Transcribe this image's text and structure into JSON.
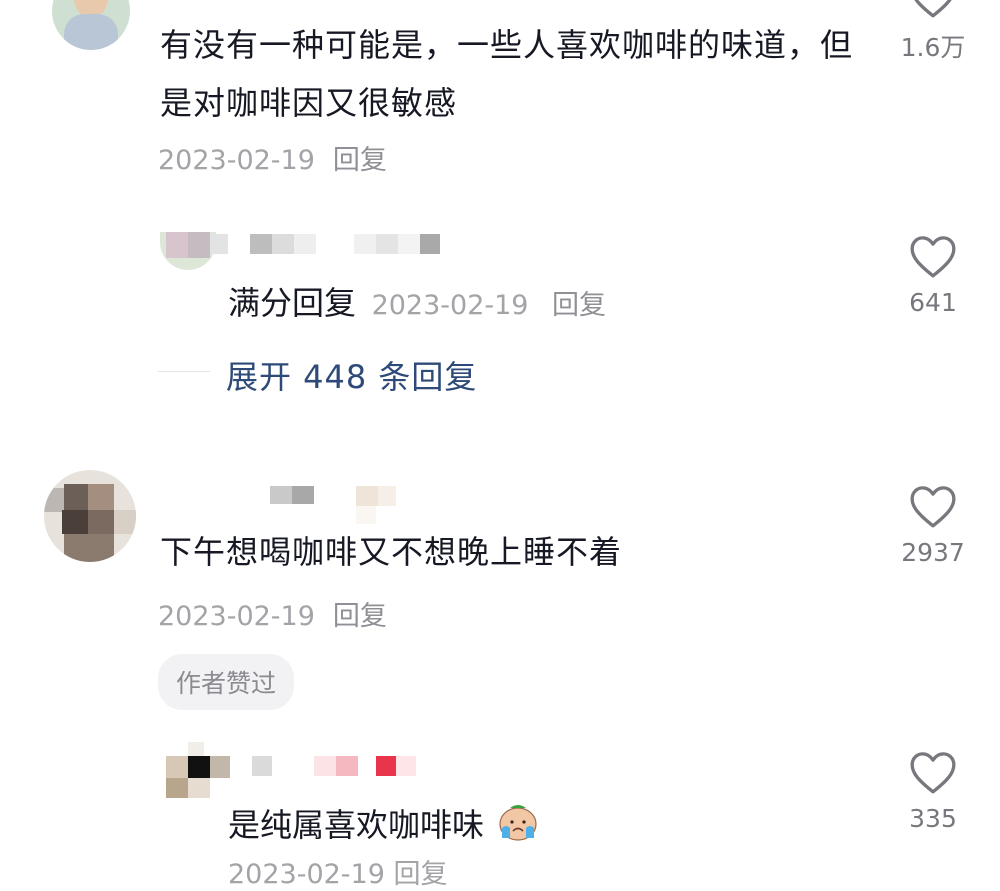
{
  "comments": [
    {
      "text": "有没有一种可能是，一些人喜欢咖啡的味道，但是对咖啡因又很敏感",
      "date": "2023-02-19",
      "reply_label": "回复",
      "like_count": "1.6万",
      "reply": {
        "prefix": "满分回复",
        "date": "2023-02-19",
        "reply_label": "回复",
        "like_count": "641"
      },
      "expand_label": "展开 448 条回复"
    },
    {
      "text": "下午想喝咖啡又不想晚上睡不着",
      "date": "2023-02-19",
      "reply_label": "回复",
      "like_count": "2937",
      "author_badge": "作者赞过",
      "reply": {
        "text": "是纯属喜欢咖啡味",
        "emoji": "crying-face-emoji",
        "like_count": "335",
        "date_partial": "2023-02-19 回复"
      }
    }
  ],
  "colors": {
    "text": "#161823",
    "meta": "#a3a3a8",
    "link": "#2e4a78",
    "heart": "#77787d"
  }
}
